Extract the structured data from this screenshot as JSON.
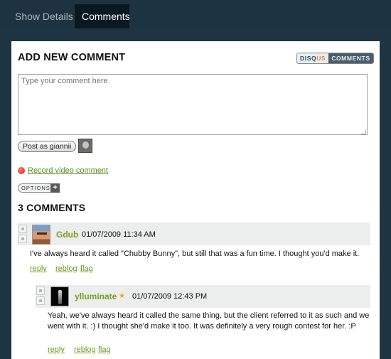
{
  "tabs": {
    "show_details": "Show Details",
    "comments": "Comments"
  },
  "add_comment": {
    "heading": "ADD NEW COMMENT",
    "brand_left": "DISQ",
    "brand_accent": "US",
    "brand_right": "COMMENTS",
    "placeholder": "Type your comment here.",
    "post_button": "Post as giannii",
    "record_video": "Record video comment",
    "options": "OPTIONS",
    "options_plus": "+"
  },
  "comments_heading": "3 COMMENTS",
  "comments": [
    {
      "author": "Gdub",
      "datetime": "01/07/2009 11:34 AM",
      "body": "I've always heard it called \"Chubby Bunny\", but still that was a fun time. I thought you'd make it.",
      "reply": "reply",
      "reblog": "reblog",
      "flag": "flag"
    },
    {
      "author": "ylluminate",
      "star": "★",
      "datetime": "01/07/2009 12:43 PM",
      "body": "Yeah, we've always heard it called the same thing, but the client referred to it as such and we went with it. :) I thought she'd make it too. It was definitely a very rough contest for her. :P",
      "reply": "reply",
      "reblog": "reblog",
      "flag": "flag"
    }
  ],
  "colors": {
    "background": "#1f3442",
    "active_tab": "#0a1822",
    "link_green": "#6f9a1e",
    "author_green": "#7aa023",
    "record_red": "#d0231a"
  }
}
